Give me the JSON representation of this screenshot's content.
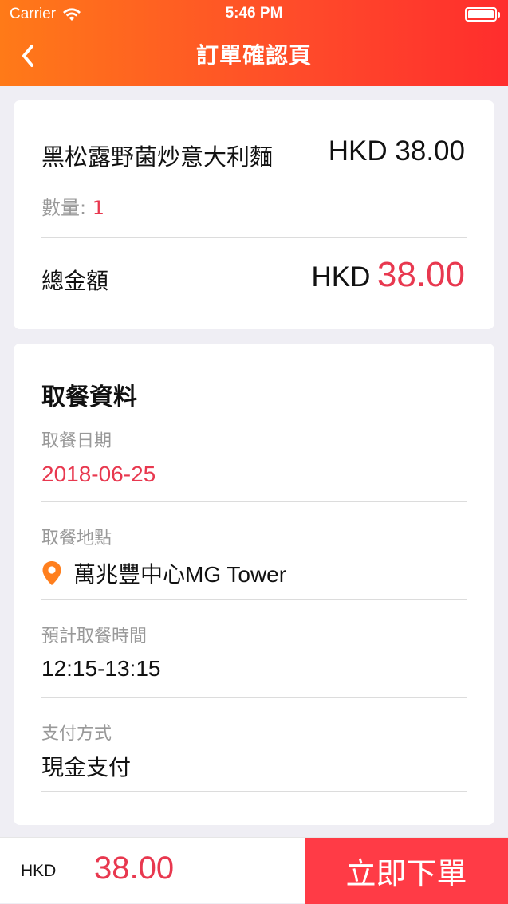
{
  "status_bar": {
    "carrier": "Carrier",
    "time": "5:46 PM"
  },
  "nav": {
    "title": "訂單確認頁",
    "back_icon": "chevron-left-icon"
  },
  "order": {
    "item_name": "黑松露野菌炒意大利麵",
    "item_price": "HKD 38.00",
    "quantity_label": "數量:",
    "quantity_value": "1",
    "total_label": "總金額",
    "total_currency": "HKD",
    "total_value": "38.00"
  },
  "pickup": {
    "section_title": "取餐資料",
    "date_label": "取餐日期",
    "date_value": "2018-06-25",
    "location_label": "取餐地點",
    "location_value": "萬兆豐中心MG Tower",
    "time_label": "預計取餐時間",
    "time_value": "12:15-13:15",
    "payment_label": "支付方式",
    "payment_value": "現金支付"
  },
  "footer": {
    "currency": "HKD",
    "amount": "38.00",
    "place_order_label": "立即下單"
  },
  "colors": {
    "accent_red": "#e8384f",
    "button_red": "#ff3b46",
    "header_gradient_start": "#ff7a18",
    "header_gradient_end": "#ff2d2d",
    "pin_orange": "#ff7f1e"
  }
}
